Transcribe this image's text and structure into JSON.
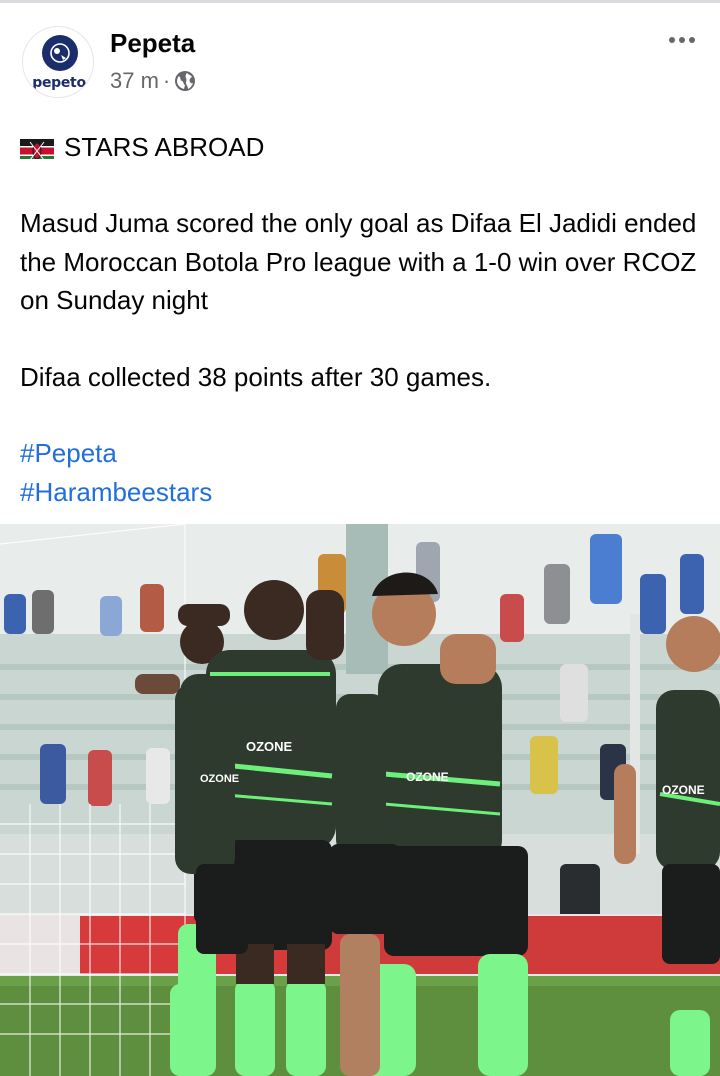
{
  "post": {
    "page_name": "Pepeta",
    "logo_text": "pepeto",
    "time_ago": "37 m",
    "separator": "·",
    "visibility_icon": "globe-icon",
    "more_icon": "more-options-icon",
    "headline": "STARS ABROAD",
    "headline_icon": "kenya-flag-icon",
    "paragraph_1": "Masud Juma scored the only goal as Difaa El Jadidi ended the Moroccan Botola Pro league with a 1-0 win over RCOZ on Sunday night",
    "paragraph_2": "Difaa collected 38 points after 30 games.",
    "hashtags": [
      "#Pepeta",
      "#Harambeestars"
    ]
  },
  "photo": {
    "jersey_sponsor": "OZONE",
    "kit_colors": {
      "shirt": "#2f3a2f",
      "trim": "#6cf07a",
      "shorts": "#1a1d1c",
      "socks": "#7cf58b"
    }
  },
  "colors": {
    "link": "#216fdb",
    "meta": "#65676b",
    "text": "#050505"
  }
}
